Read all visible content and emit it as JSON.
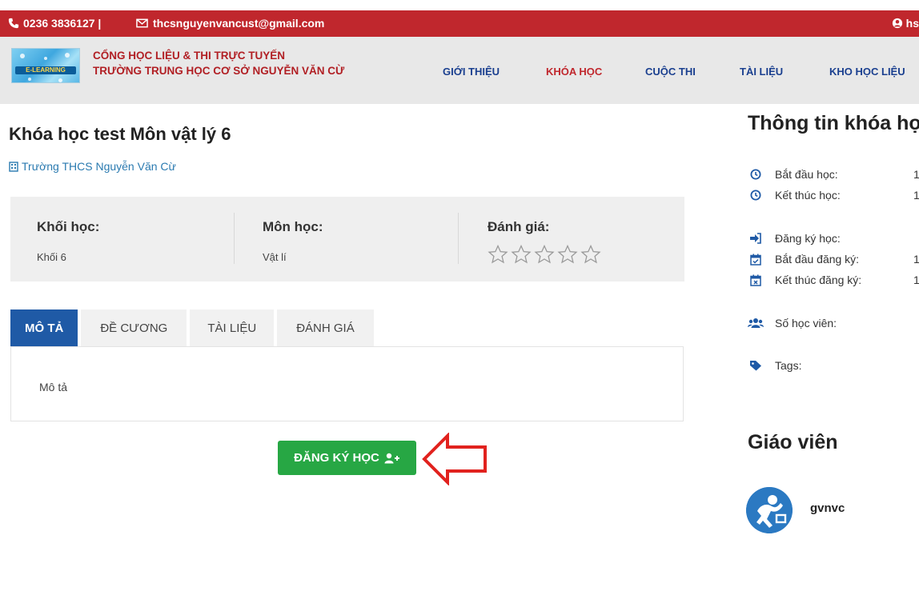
{
  "topbar": {
    "phone": "0236 3836127 |",
    "email": "thcsnguyenvancust@gmail.com",
    "user": "hs"
  },
  "header": {
    "logo_text": "E-LEARNING",
    "site_title_line1": "CỔNG HỌC LIỆU & THI TRỰC TUYẾN",
    "site_title_line2": "TRƯỜNG TRUNG HỌC CƠ SỞ NGUYỄN VĂN CỪ",
    "nav": [
      {
        "label": "GIỚI THIỆU",
        "active": false
      },
      {
        "label": "KHÓA HỌC",
        "active": true
      },
      {
        "label": "CUỘC THI",
        "active": false
      },
      {
        "label": "TÀI LIỆU",
        "active": false
      },
      {
        "label": "KHO HỌC LIỆU",
        "active": false
      }
    ]
  },
  "course": {
    "title": "Khóa học test Môn vật lý 6",
    "school": "Trường THCS Nguyễn Văn Cừ",
    "grade_label": "Khối học:",
    "grade_value": "Khối 6",
    "subject_label": "Môn học:",
    "subject_value": "Vật lí",
    "rating_label": "Đánh giá:",
    "rating_stars": 0,
    "rating_max": 5
  },
  "tabs": [
    {
      "label": "MÔ TẢ",
      "active": true
    },
    {
      "label": "ĐỀ CƯƠNG",
      "active": false
    },
    {
      "label": "TÀI LIỆU",
      "active": false
    },
    {
      "label": "ĐÁNH GIÁ",
      "active": false
    }
  ],
  "tab_content": "Mô tả",
  "register_button": "ĐĂNG KÝ HỌC",
  "sidebar": {
    "title": "Thông tin khóa học",
    "rows": [
      {
        "icon": "clock-icon",
        "label": "Bắt đầu học:",
        "value": "1"
      },
      {
        "icon": "clock-icon",
        "label": "Kết thúc học:",
        "value": "1"
      },
      {
        "icon": "sign-in-icon",
        "label": "Đăng ký học:",
        "value": ""
      },
      {
        "icon": "calendar-check-icon",
        "label": "Bắt đầu đăng ký:",
        "value": "1"
      },
      {
        "icon": "calendar-times-icon",
        "label": "Kết thúc đăng ký:",
        "value": "1"
      },
      {
        "icon": "users-icon",
        "label": "Số học viên:",
        "value": ""
      },
      {
        "icon": "tag-icon",
        "label": "Tags:",
        "value": ""
      }
    ],
    "teacher_title": "Giáo viên",
    "teacher_name": "gvnvc"
  },
  "colors": {
    "topbar": "#c0272d",
    "nav_text": "#1a3f8f",
    "nav_active": "#c0272d",
    "tab_active": "#1f5aa6",
    "register_button": "#27a744",
    "arrow": "#e1221e"
  }
}
